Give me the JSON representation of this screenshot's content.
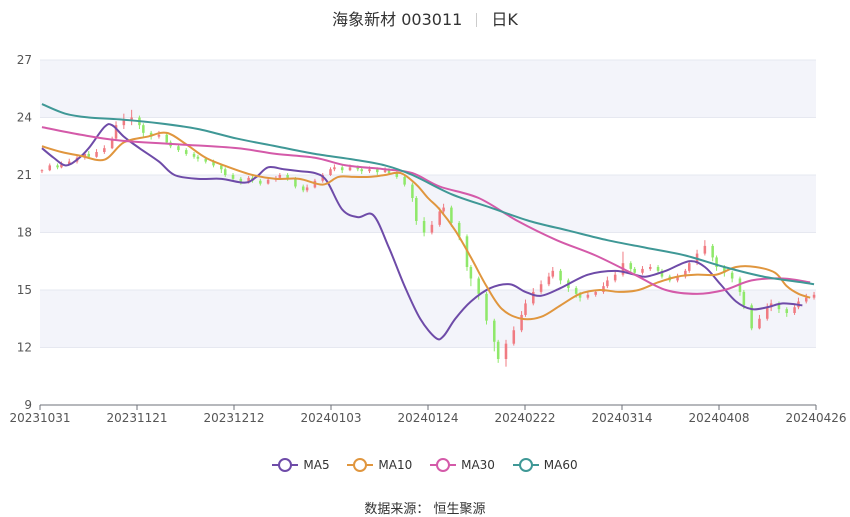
{
  "header": {
    "title": "海象新材 003011",
    "period": "日K"
  },
  "source": "数据来源： 恒生聚源",
  "colors": {
    "up": "#f07b82",
    "down": "#8fe86a",
    "band": "#f3f4fa",
    "grid": "#e6e8f0"
  },
  "legend": [
    {
      "name": "MA5",
      "color": "#6e4ba8"
    },
    {
      "name": "MA10",
      "color": "#e0963e"
    },
    {
      "name": "MA30",
      "color": "#d45aa9"
    },
    {
      "name": "MA60",
      "color": "#3f9896"
    }
  ],
  "chart_data": {
    "type": "candlestick",
    "ylim": [
      9,
      27
    ],
    "y_ticks": [
      9,
      12,
      15,
      18,
      21,
      24,
      27
    ],
    "x_start": "20231031",
    "x_end": "20240426",
    "x_tick_labels": [
      "20231031",
      "20231121",
      "20231212",
      "20240103",
      "20240124",
      "20240222",
      "20240314",
      "20240408",
      "20240426"
    ],
    "candles": [
      [
        21.2,
        21.25,
        21.1,
        21.3
      ],
      [
        21.25,
        21.5,
        21.2,
        21.6
      ],
      [
        21.5,
        21.4,
        21.3,
        21.6
      ],
      [
        21.4,
        21.55,
        21.35,
        21.7
      ],
      [
        21.55,
        21.7,
        21.5,
        21.85
      ],
      [
        21.7,
        21.9,
        21.6,
        22.05
      ],
      [
        21.9,
        22.1,
        21.8,
        22.2
      ],
      [
        22.1,
        21.95,
        21.85,
        22.25
      ],
      [
        21.95,
        22.2,
        21.9,
        22.35
      ],
      [
        22.2,
        22.4,
        22.1,
        22.55
      ],
      [
        22.4,
        22.9,
        22.35,
        23.0
      ],
      [
        22.9,
        23.6,
        22.8,
        23.8
      ],
      [
        23.6,
        23.9,
        23.4,
        24.2
      ],
      [
        23.9,
        24.0,
        23.6,
        24.4
      ],
      [
        24.0,
        23.6,
        23.4,
        24.1
      ],
      [
        23.6,
        23.2,
        23.0,
        23.7
      ],
      [
        23.2,
        23.0,
        22.85,
        23.3
      ],
      [
        23.0,
        23.1,
        22.9,
        23.3
      ],
      [
        23.1,
        22.7,
        22.6,
        23.2
      ],
      [
        22.7,
        22.5,
        22.4,
        22.8
      ],
      [
        22.5,
        22.3,
        22.2,
        22.6
      ],
      [
        22.3,
        22.1,
        22.0,
        22.4
      ],
      [
        22.1,
        21.95,
        21.85,
        22.2
      ],
      [
        21.95,
        21.85,
        21.7,
        22.05
      ],
      [
        21.85,
        21.7,
        21.6,
        21.95
      ],
      [
        21.7,
        21.5,
        21.4,
        21.8
      ],
      [
        21.5,
        21.3,
        21.1,
        21.6
      ],
      [
        21.3,
        21.0,
        20.9,
        21.4
      ],
      [
        21.0,
        20.8,
        20.7,
        21.1
      ],
      [
        20.8,
        20.6,
        20.5,
        20.9
      ],
      [
        20.6,
        20.85,
        20.55,
        20.95
      ],
      [
        20.85,
        20.7,
        20.6,
        20.95
      ],
      [
        20.7,
        20.55,
        20.45,
        20.8
      ],
      [
        20.55,
        20.75,
        20.5,
        20.85
      ],
      [
        20.75,
        20.85,
        20.65,
        20.95
      ],
      [
        20.85,
        21.0,
        20.8,
        21.1
      ],
      [
        21.0,
        20.8,
        20.7,
        21.1
      ],
      [
        20.8,
        20.4,
        20.3,
        20.9
      ],
      [
        20.4,
        20.2,
        20.1,
        20.5
      ],
      [
        20.2,
        20.35,
        20.1,
        20.5
      ],
      [
        20.35,
        20.7,
        20.3,
        20.8
      ],
      [
        20.7,
        21.0,
        20.6,
        21.1
      ],
      [
        21.0,
        21.3,
        20.95,
        21.4
      ],
      [
        21.3,
        21.4,
        21.2,
        21.55
      ],
      [
        21.4,
        21.25,
        21.1,
        21.5
      ],
      [
        21.25,
        21.4,
        21.2,
        21.55
      ],
      [
        21.4,
        21.3,
        21.2,
        21.5
      ],
      [
        21.3,
        21.2,
        21.05,
        21.4
      ],
      [
        21.2,
        21.3,
        21.1,
        21.45
      ],
      [
        21.3,
        21.15,
        21.0,
        21.4
      ],
      [
        21.15,
        21.25,
        21.1,
        21.4
      ],
      [
        21.25,
        21.1,
        21.0,
        21.35
      ],
      [
        21.1,
        20.9,
        20.8,
        21.2
      ],
      [
        20.9,
        20.5,
        20.4,
        21.0
      ],
      [
        20.5,
        19.8,
        19.6,
        20.6
      ],
      [
        19.8,
        18.6,
        18.4,
        19.9
      ],
      [
        18.6,
        18.0,
        17.8,
        18.8
      ],
      [
        18.0,
        18.4,
        17.9,
        18.6
      ],
      [
        18.4,
        19.1,
        18.3,
        19.3
      ],
      [
        19.1,
        19.3,
        18.9,
        19.5
      ],
      [
        19.3,
        18.5,
        18.3,
        19.4
      ],
      [
        18.5,
        17.8,
        17.6,
        18.6
      ],
      [
        17.8,
        16.2,
        16.0,
        17.9
      ],
      [
        16.2,
        15.6,
        15.2,
        16.3
      ],
      [
        15.6,
        14.8,
        14.5,
        15.7
      ],
      [
        14.8,
        13.4,
        13.2,
        14.9
      ],
      [
        13.4,
        12.3,
        11.8,
        13.5
      ],
      [
        12.3,
        11.4,
        11.2,
        12.4
      ],
      [
        11.4,
        12.2,
        11.0,
        12.4
      ],
      [
        12.2,
        12.9,
        12.1,
        13.1
      ],
      [
        12.9,
        13.7,
        12.8,
        13.9
      ],
      [
        13.7,
        14.3,
        13.6,
        14.5
      ],
      [
        14.3,
        14.9,
        14.2,
        15.1
      ],
      [
        14.9,
        15.3,
        14.8,
        15.5
      ],
      [
        15.3,
        15.7,
        15.2,
        15.9
      ],
      [
        15.7,
        16.0,
        15.6,
        16.2
      ],
      [
        16.0,
        15.5,
        15.3,
        16.1
      ],
      [
        15.5,
        15.1,
        14.9,
        15.6
      ],
      [
        15.1,
        14.8,
        14.6,
        15.2
      ],
      [
        14.8,
        14.6,
        14.4,
        14.9
      ],
      [
        14.6,
        14.75,
        14.5,
        14.9
      ],
      [
        14.75,
        14.9,
        14.65,
        15.0
      ],
      [
        14.9,
        15.2,
        14.8,
        15.4
      ],
      [
        15.2,
        15.5,
        15.1,
        15.7
      ],
      [
        15.5,
        15.8,
        15.4,
        16.0
      ],
      [
        15.8,
        16.4,
        15.7,
        17.0
      ],
      [
        16.4,
        16.1,
        15.9,
        16.5
      ],
      [
        16.1,
        15.9,
        15.8,
        16.2
      ],
      [
        15.9,
        16.1,
        15.8,
        16.25
      ],
      [
        16.1,
        16.2,
        16.0,
        16.35
      ],
      [
        16.2,
        16.0,
        15.9,
        16.3
      ],
      [
        16.0,
        15.7,
        15.6,
        16.1
      ],
      [
        15.7,
        15.5,
        15.4,
        15.8
      ],
      [
        15.5,
        15.7,
        15.4,
        15.85
      ],
      [
        15.7,
        16.0,
        15.6,
        16.1
      ],
      [
        16.0,
        16.4,
        15.9,
        16.55
      ],
      [
        16.4,
        16.9,
        16.3,
        17.1
      ],
      [
        16.9,
        17.3,
        16.8,
        17.6
      ],
      [
        17.3,
        16.7,
        16.5,
        17.4
      ],
      [
        16.7,
        16.2,
        16.0,
        16.8
      ],
      [
        16.2,
        15.9,
        15.7,
        16.3
      ],
      [
        15.9,
        15.6,
        15.4,
        16.0
      ],
      [
        15.6,
        14.9,
        14.7,
        15.7
      ],
      [
        14.9,
        14.2,
        14.0,
        15.0
      ],
      [
        14.2,
        13.0,
        12.9,
        14.3
      ],
      [
        13.0,
        13.5,
        12.95,
        13.7
      ],
      [
        13.5,
        14.1,
        13.4,
        14.3
      ],
      [
        14.1,
        14.3,
        13.9,
        14.5
      ],
      [
        14.3,
        14.0,
        13.8,
        14.4
      ],
      [
        14.0,
        13.8,
        13.6,
        14.1
      ],
      [
        13.8,
        14.1,
        13.7,
        14.25
      ],
      [
        14.1,
        14.4,
        14.0,
        14.6
      ],
      [
        14.4,
        14.6,
        14.3,
        14.8
      ],
      [
        14.6,
        14.75,
        14.5,
        14.9
      ]
    ],
    "series": [
      {
        "name": "MA5",
        "points": [
          [
            0,
            22.4
          ],
          [
            3,
            21.9
          ],
          [
            6,
            21.5
          ],
          [
            9,
            21.8
          ],
          [
            12,
            22.4
          ],
          [
            16,
            23.5
          ],
          [
            18,
            23.6
          ],
          [
            21,
            23.0
          ],
          [
            25,
            22.4
          ],
          [
            30,
            21.7
          ],
          [
            34,
            21.0
          ],
          [
            40,
            20.8
          ],
          [
            46,
            20.8
          ],
          [
            52,
            20.6
          ],
          [
            55,
            20.9
          ],
          [
            58,
            21.4
          ],
          [
            62,
            21.3
          ],
          [
            66,
            21.2
          ],
          [
            70,
            21.1
          ],
          [
            73,
            20.7
          ],
          [
            77,
            19.2
          ],
          [
            81,
            18.8
          ],
          [
            85,
            18.9
          ],
          [
            89,
            17.2
          ],
          [
            93,
            15.2
          ],
          [
            97,
            13.5
          ],
          [
            101,
            12.5
          ],
          [
            103,
            12.6
          ],
          [
            106,
            13.5
          ],
          [
            110,
            14.4
          ],
          [
            115,
            15.1
          ],
          [
            120,
            15.3
          ],
          [
            124,
            14.9
          ],
          [
            128,
            14.7
          ],
          [
            133,
            15.1
          ],
          [
            140,
            15.8
          ],
          [
            147,
            16.0
          ],
          [
            152,
            15.8
          ],
          [
            155,
            15.7
          ],
          [
            160,
            16.0
          ],
          [
            166,
            16.5
          ],
          [
            170,
            16.2
          ],
          [
            174,
            15.3
          ],
          [
            178,
            14.4
          ],
          [
            182,
            14.0
          ],
          [
            186,
            14.1
          ],
          [
            190,
            14.3
          ],
          [
            195,
            14.2
          ]
        ]
      },
      {
        "name": "MA10",
        "points": [
          [
            0,
            22.5
          ],
          [
            5,
            22.2
          ],
          [
            10,
            22.0
          ],
          [
            16,
            21.8
          ],
          [
            21,
            22.7
          ],
          [
            27,
            23.0
          ],
          [
            32,
            23.2
          ],
          [
            37,
            22.6
          ],
          [
            42,
            21.9
          ],
          [
            48,
            21.4
          ],
          [
            54,
            21.0
          ],
          [
            60,
            20.8
          ],
          [
            66,
            20.8
          ],
          [
            72,
            20.5
          ],
          [
            76,
            20.9
          ],
          [
            80,
            20.9
          ],
          [
            84,
            20.9
          ],
          [
            88,
            21.0
          ],
          [
            92,
            21.1
          ],
          [
            96,
            20.5
          ],
          [
            99,
            19.8
          ],
          [
            102,
            19.2
          ],
          [
            106,
            18.1
          ],
          [
            110,
            16.7
          ],
          [
            114,
            15.2
          ],
          [
            118,
            14.0
          ],
          [
            123,
            13.5
          ],
          [
            128,
            13.6
          ],
          [
            133,
            14.2
          ],
          [
            138,
            14.8
          ],
          [
            143,
            15.0
          ],
          [
            148,
            14.9
          ],
          [
            153,
            15.0
          ],
          [
            158,
            15.4
          ],
          [
            163,
            15.7
          ],
          [
            168,
            15.8
          ],
          [
            173,
            15.8
          ],
          [
            178,
            16.2
          ],
          [
            183,
            16.2
          ],
          [
            188,
            15.9
          ],
          [
            191,
            15.2
          ],
          [
            194,
            14.8
          ],
          [
            197,
            14.6
          ]
        ]
      },
      {
        "name": "MA30",
        "points": [
          [
            0,
            23.5
          ],
          [
            10,
            23.1
          ],
          [
            20,
            22.8
          ],
          [
            35,
            22.6
          ],
          [
            50,
            22.4
          ],
          [
            60,
            22.1
          ],
          [
            70,
            21.9
          ],
          [
            78,
            21.5
          ],
          [
            88,
            21.3
          ],
          [
            95,
            21.1
          ],
          [
            102,
            20.4
          ],
          [
            112,
            19.8
          ],
          [
            122,
            18.6
          ],
          [
            132,
            17.6
          ],
          [
            142,
            16.8
          ],
          [
            152,
            15.8
          ],
          [
            160,
            15.0
          ],
          [
            168,
            14.8
          ],
          [
            175,
            15.0
          ],
          [
            182,
            15.5
          ],
          [
            190,
            15.6
          ],
          [
            197,
            15.4
          ]
        ]
      },
      {
        "name": "MA60",
        "points": [
          [
            0,
            24.7
          ],
          [
            6,
            24.2
          ],
          [
            12,
            24.0
          ],
          [
            20,
            23.9
          ],
          [
            30,
            23.7
          ],
          [
            40,
            23.4
          ],
          [
            50,
            22.9
          ],
          [
            60,
            22.5
          ],
          [
            70,
            22.1
          ],
          [
            80,
            21.8
          ],
          [
            88,
            21.5
          ],
          [
            95,
            21.0
          ],
          [
            105,
            20.0
          ],
          [
            115,
            19.3
          ],
          [
            125,
            18.6
          ],
          [
            135,
            18.1
          ],
          [
            145,
            17.6
          ],
          [
            155,
            17.2
          ],
          [
            165,
            16.8
          ],
          [
            175,
            16.2
          ],
          [
            185,
            15.7
          ],
          [
            195,
            15.4
          ],
          [
            198,
            15.3
          ]
        ]
      }
    ]
  }
}
